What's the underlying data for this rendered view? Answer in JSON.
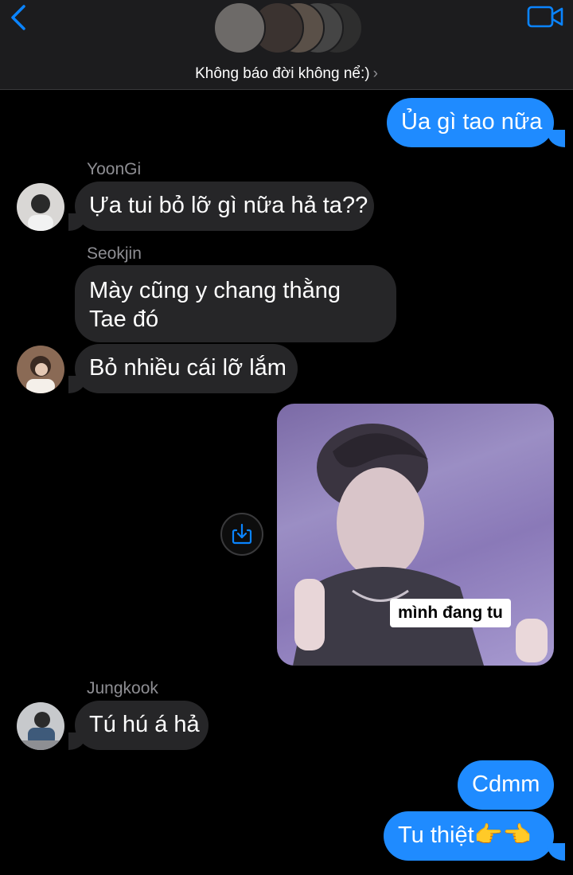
{
  "header": {
    "group_name": "Không báo đời không nể:)",
    "chevron": "›",
    "icons": [
      "back-chevron-icon",
      "video-call-icon",
      "group-avatars"
    ]
  },
  "messages": [
    {
      "id": "m1",
      "direction": "out",
      "text": "Ủa gì tao nữa"
    },
    {
      "id": "m2",
      "direction": "in",
      "sender": "YoonGi",
      "text": "Ựa tui bỏ lỡ gì nữa hả ta??"
    },
    {
      "id": "m3",
      "direction": "in",
      "sender": "Seokjin",
      "lines": [
        "Mày cũng y chang thằng",
        "Tae đó"
      ]
    },
    {
      "id": "m4",
      "direction": "in",
      "text": "Bỏ nhiều cái lỡ lắm"
    },
    {
      "id": "m5",
      "direction": "out",
      "type": "image",
      "caption": "mình đang tu"
    },
    {
      "id": "m6",
      "direction": "in",
      "sender": "Jungkook",
      "text": "Tú hú á hả"
    },
    {
      "id": "m7",
      "direction": "out",
      "text": "Cdmm"
    },
    {
      "id": "m8",
      "direction": "out",
      "text": "Tu thiệt👉👈"
    }
  ],
  "colors": {
    "outgoing": "#1f8bff",
    "incoming": "#262628",
    "accent": "#0a84ff",
    "background": "#000000"
  }
}
